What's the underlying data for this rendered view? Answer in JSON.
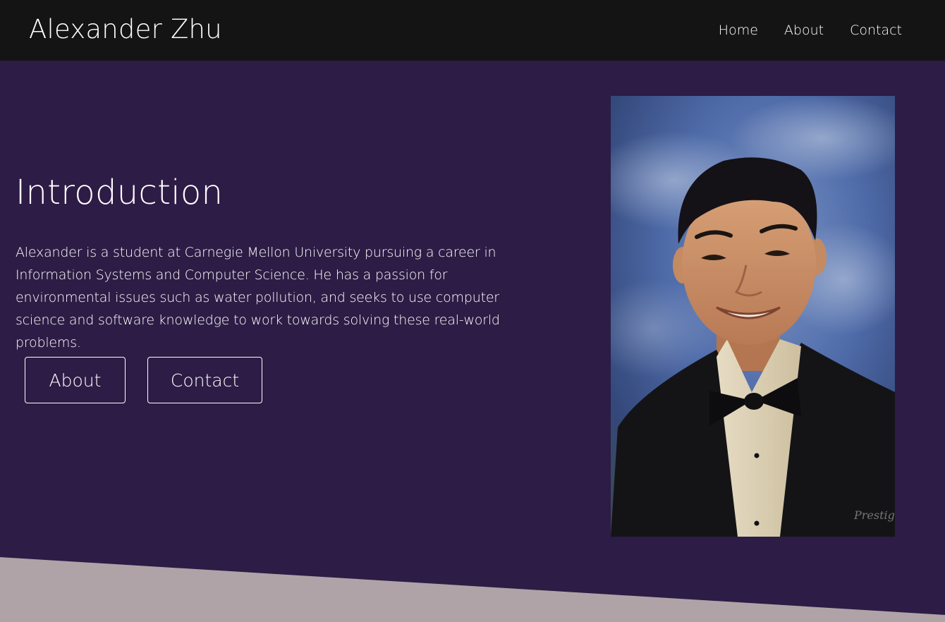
{
  "site": {
    "brand": "Alexander Zhu"
  },
  "nav": {
    "items": [
      {
        "label": "Home"
      },
      {
        "label": "About"
      },
      {
        "label": "Contact"
      }
    ]
  },
  "hero": {
    "title": "Introduction",
    "paragraph": "Alexander is a student at Carnegie Mellon University pursuing a career in Information Systems and Computer Science. He has a passion for environmental issues such as water pollution, and seeks to use computer science and software knowledge to work towards solving these real-world problems.",
    "buttons": {
      "about_label": "About",
      "contact_label": "Contact"
    },
    "portrait_alt": "Portrait of Alexander Zhu"
  },
  "colors": {
    "navbar": "#141414",
    "hero_background": "#2d1c45",
    "bottom_band": "#b0a3a8",
    "text": "#ffffff"
  }
}
